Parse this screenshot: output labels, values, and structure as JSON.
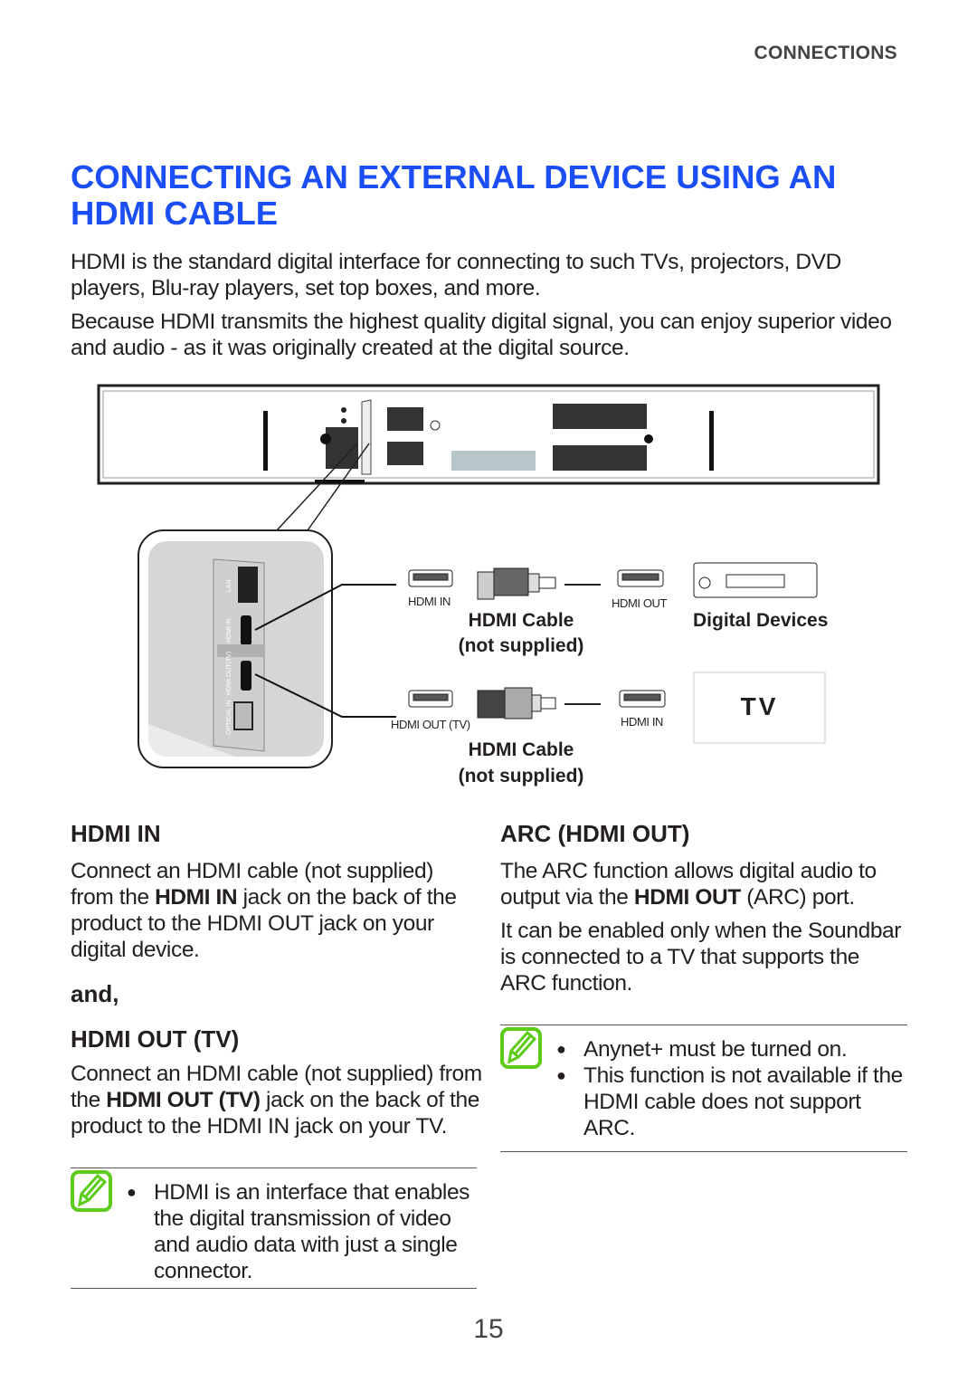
{
  "header": {
    "section": "CONNECTIONS"
  },
  "title": "CONNECTING AN EXTERNAL DEVICE USING AN HDMI CABLE",
  "intro": [
    "HDMI is the standard digital interface for connecting to such TVs, projectors, DVD players, Blu-ray players, set top boxes, and more.",
    "Because HDMI transmits the highest quality digital signal, you can enjoy superior video and audio - as it was originally created at the digital source."
  ],
  "diagram": {
    "panel_ports": [
      "LAN",
      "HDMI IN",
      "HDMI OUT(TV)",
      "OPTICAL IN"
    ],
    "top": {
      "left_port": "HDMI IN",
      "cable": "HDMI Cable",
      "cable_note": "(not supplied)",
      "right_port": "HDMI OUT",
      "device": "Digital Devices"
    },
    "bottom": {
      "left_port": "HDMI OUT (TV)",
      "cable": "HDMI Cable",
      "cable_note": "(not supplied)",
      "right_port": "HDMI IN",
      "device": "TV"
    }
  },
  "left": {
    "h1": "HDMI IN",
    "p1": {
      "a": "Connect an HDMI cable (not supplied) from the ",
      "b": "HDMI IN",
      "c": " jack on the back of the product to the HDMI OUT jack on your digital device."
    },
    "and": "and,",
    "h2": "HDMI OUT (TV)",
    "p2": {
      "a": "Connect an HDMI cable (not supplied) from the ",
      "b": "HDMI OUT (TV)",
      "c": " jack on the back of the product to the HDMI IN jack on your TV."
    },
    "note": [
      "HDMI is an interface that enables the digital transmission of video and audio data with just a single connector."
    ]
  },
  "right": {
    "h1": "ARC (HDMI OUT)",
    "p1": {
      "a": "The ARC function allows digital audio to output via the ",
      "b": "HDMI OUT",
      "c": " (ARC) port."
    },
    "p2": "It can be enabled only when the Soundbar is connected to a TV that supports the ARC function.",
    "note": [
      "Anynet+ must be turned on.",
      "This function is not available if the HDMI cable does not support ARC."
    ]
  },
  "page_number": "15",
  "colors": {
    "title": "#1b4ff5",
    "note_icon": "#5ccc1a"
  }
}
